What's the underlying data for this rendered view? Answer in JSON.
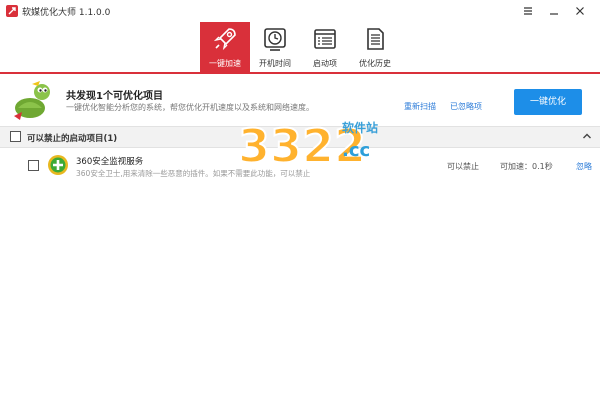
{
  "app": {
    "title": "软媒优化大师 1.1.0.0"
  },
  "window_controls": {
    "menu_icon": "menu-icon",
    "minimize_icon": "minimize-icon",
    "close_icon": "close-icon"
  },
  "tabs": [
    {
      "label": "一键加速",
      "icon": "rocket-icon",
      "active": true
    },
    {
      "label": "开机时间",
      "icon": "clock-icon",
      "active": false
    },
    {
      "label": "启动项",
      "icon": "startup-list-icon",
      "active": false
    },
    {
      "label": "优化历史",
      "icon": "history-document-icon",
      "active": false
    }
  ],
  "banner": {
    "title": "共发现1个可优化项目",
    "description": "一键优化智能分析您的系统，帮您优化开机速度以及系统和网络速度。",
    "rescan_label": "重新扫描",
    "ignored_label": "已忽略项",
    "optimize_button": "一键优化"
  },
  "group": {
    "title": "可以禁止的启动项目(1)"
  },
  "items": [
    {
      "name": "360安全监视服务",
      "description": "360安全卫士,用来清除一些恶意的插件。如果不需要此功能，可以禁止",
      "status": "可以禁止",
      "speed": "可加速：0.1秒",
      "ignore_label": "忽略"
    }
  ],
  "watermark": {
    "text": "软件站",
    "number": "3322",
    "suffix": ".cc"
  },
  "colors": {
    "accent_red": "#d9303a",
    "primary_blue": "#1d8ee8",
    "link_blue": "#2b7bd8"
  }
}
